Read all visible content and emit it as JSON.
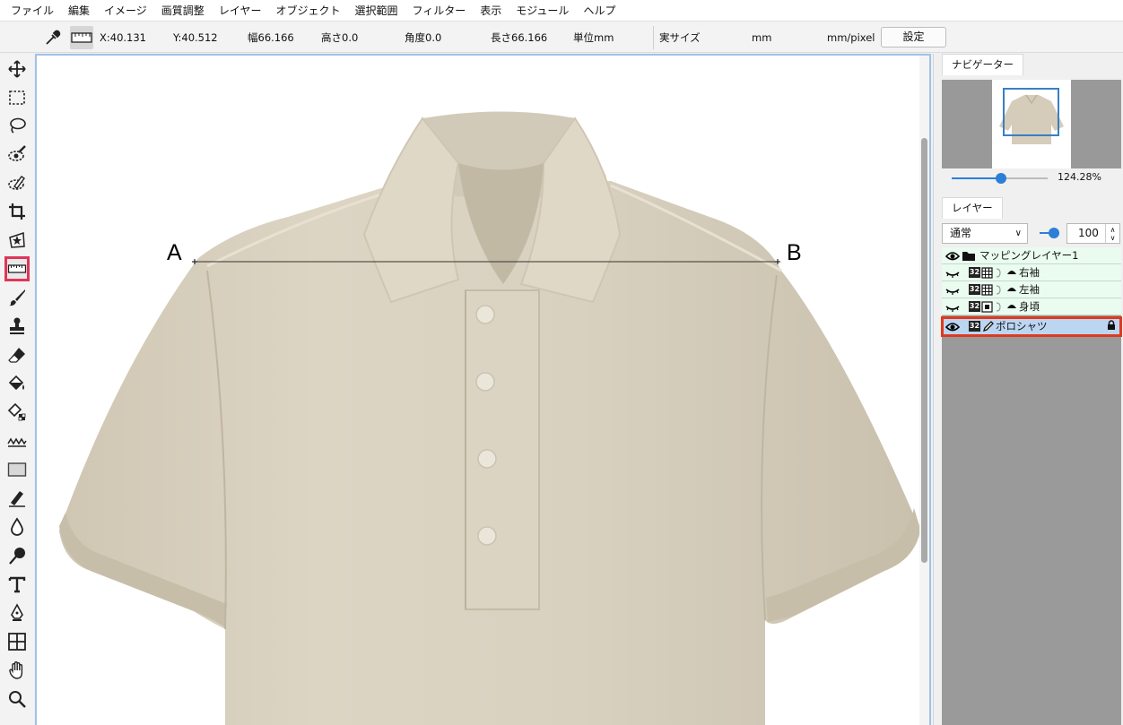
{
  "menu": [
    "ファイル",
    "編集",
    "イメージ",
    "画質調整",
    "レイヤー",
    "オブジェクト",
    "選択範囲",
    "フィルター",
    "表示",
    "モジュール",
    "ヘルプ"
  ],
  "options": {
    "x": "X:40.131",
    "y": "Y:40.512",
    "width": "幅66.166",
    "height": "高さ0.0",
    "angle": "角度0.0",
    "length": "長さ66.166",
    "unit": "単位mm",
    "actual_size": "実サイズ",
    "mm": "mm",
    "mm_per_pixel": "mm/pixel",
    "settings": "設定"
  },
  "tools": [
    "move-tool-icon",
    "rect-select-icon",
    "lasso-icon",
    "eye-brush-icon",
    "eye-pen-icon",
    "crop-icon",
    "star-select-icon",
    "ruler-icon",
    "brush-icon",
    "stamp-icon",
    "eraser-icon",
    "fill-bucket-icon",
    "pattern-fill-icon",
    "wave-icon",
    "rectangle-icon",
    "pen-edit-icon",
    "drop-icon",
    "dodge-icon",
    "text-icon",
    "pen-tool-icon",
    "grid-icon",
    "hand-icon",
    "zoom-icon"
  ],
  "canvas": {
    "point_a": "A",
    "point_b": "B"
  },
  "navigator": {
    "tab": "ナビゲーター",
    "zoom": "124.28%",
    "zoom_level": 0.5
  },
  "layers_panel": {
    "tab": "レイヤー",
    "blend_mode": "通常",
    "opacity": "100",
    "items": [
      {
        "name": "マッピングレイヤー1",
        "badge": ""
      },
      {
        "name": "右袖",
        "badge": "32"
      },
      {
        "name": "左袖",
        "badge": "32"
      },
      {
        "name": "身頃",
        "badge": "32"
      },
      {
        "name": "ポロシャツ",
        "badge": "32"
      }
    ]
  },
  "colors": {
    "accent": "#2b7fd6",
    "highlight_red": "#e03557",
    "layer_green": "#eafbef",
    "shirt": "#ddd5c4"
  }
}
